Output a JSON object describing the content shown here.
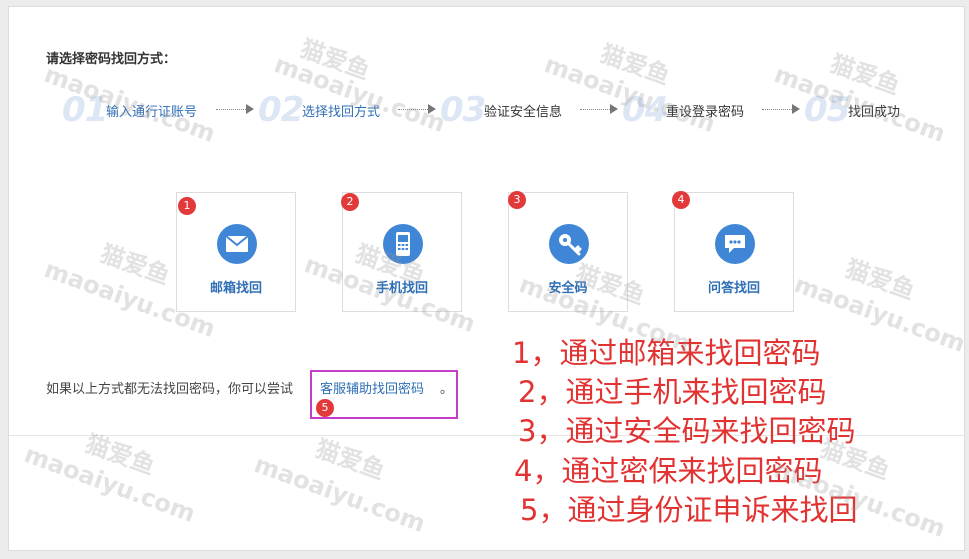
{
  "title": "请选择密码找回方式：",
  "steps": [
    {
      "num": "01",
      "label": "输入通行证账号",
      "active": true
    },
    {
      "num": "02",
      "label": "选择找回方式",
      "active": true
    },
    {
      "num": "03",
      "label": "验证安全信息",
      "active": false
    },
    {
      "num": "04",
      "label": "重设登录密码",
      "active": false
    },
    {
      "num": "05",
      "label": "找回成功",
      "active": false
    }
  ],
  "methods": [
    {
      "badge": "1",
      "label": "邮箱找回",
      "icon": "envelope-icon"
    },
    {
      "badge": "2",
      "label": "手机找回",
      "icon": "mobile-phone-icon"
    },
    {
      "badge": "3",
      "label": "安全码",
      "icon": "key-icon"
    },
    {
      "badge": "4",
      "label": "问答找回",
      "icon": "chat-bubble-icon"
    }
  ],
  "help": {
    "text": "如果以上方式都无法找回密码，你可以尝试",
    "link": "客服辅助找回密码",
    "suffix": "。",
    "badge": "5"
  },
  "annotations": [
    "1，通过邮箱来找回密码",
    "2，通过手机来找回密码",
    "3，通过安全码来找回密码",
    "4，通过密保来找回密码",
    "5，通过身份证申诉来找回"
  ],
  "watermark": {
    "cn": "猫爱鱼",
    "en": "maoaiyu.com"
  },
  "colors": {
    "accent": "#2f6fb5",
    "icon": "#3f86d6",
    "badge": "#e23a3a",
    "annotation": "#e23333",
    "highlight": "#c43cc8"
  }
}
